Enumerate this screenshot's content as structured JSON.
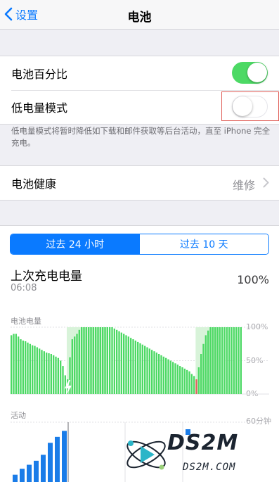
{
  "nav": {
    "back_label": "设置",
    "title": "电池"
  },
  "settings": {
    "battery_percentage": {
      "label": "电池百分比",
      "on": true
    },
    "low_power_mode": {
      "label": "低电量模式",
      "on": false
    },
    "low_power_note": "低电量模式将暂时降低如下载和邮件获取等后台活动，直至 iPhone 完全充电。"
  },
  "battery_health": {
    "label": "电池健康",
    "value": "维修"
  },
  "usage_tabs": [
    {
      "label": "过去 24 小时",
      "selected": true
    },
    {
      "label": "过去 10 天",
      "selected": false
    }
  ],
  "last_charge": {
    "label": "上次充电电量",
    "time": "06:08",
    "level": "100%"
  },
  "colors": {
    "accent": "#0a7aff",
    "toggle_on": "#4cd964",
    "battery_bar": "#4cd964",
    "low_level": "#e0605a",
    "activity_bar": "#1a7ce8"
  },
  "chart_data": [
    {
      "type": "bar",
      "title": "电池电量",
      "y_ticks": [
        "100%",
        "50%",
        "0%"
      ],
      "ylim": [
        0,
        100
      ],
      "values": [
        88,
        90,
        90,
        86,
        82,
        80,
        79,
        77,
        75,
        73,
        72,
        70,
        68,
        66,
        64,
        62,
        61,
        60,
        58,
        56,
        54,
        50,
        42,
        28,
        22,
        55,
        82,
        86,
        90,
        96,
        100,
        100,
        100,
        100,
        100,
        100,
        100,
        100,
        100,
        100,
        100,
        100,
        100,
        100,
        98,
        96,
        94,
        92,
        90,
        88,
        86,
        84,
        82,
        80,
        78,
        76,
        74,
        72,
        70,
        68,
        66,
        64,
        62,
        60,
        58,
        56,
        54,
        52,
        50,
        48,
        46,
        44,
        42,
        40,
        38,
        36,
        34,
        30,
        27,
        22,
        40,
        60,
        75,
        88,
        95,
        100,
        100,
        100,
        100,
        100,
        100,
        100,
        100,
        100,
        100,
        100,
        100,
        100,
        100
      ],
      "charging_from_index": 24,
      "charging_to_index": 41,
      "charging2_from_index": 79,
      "charging2_to_index": 89
    },
    {
      "type": "bar",
      "title": "活动",
      "y_ticks": [
        "60分钟"
      ],
      "ylim": [
        0,
        60
      ],
      "values": [
        8,
        14,
        18,
        22,
        28,
        40,
        46,
        52
      ]
    }
  ],
  "watermark": {
    "main": "DS2M",
    "sub": "DS2M.COM"
  }
}
